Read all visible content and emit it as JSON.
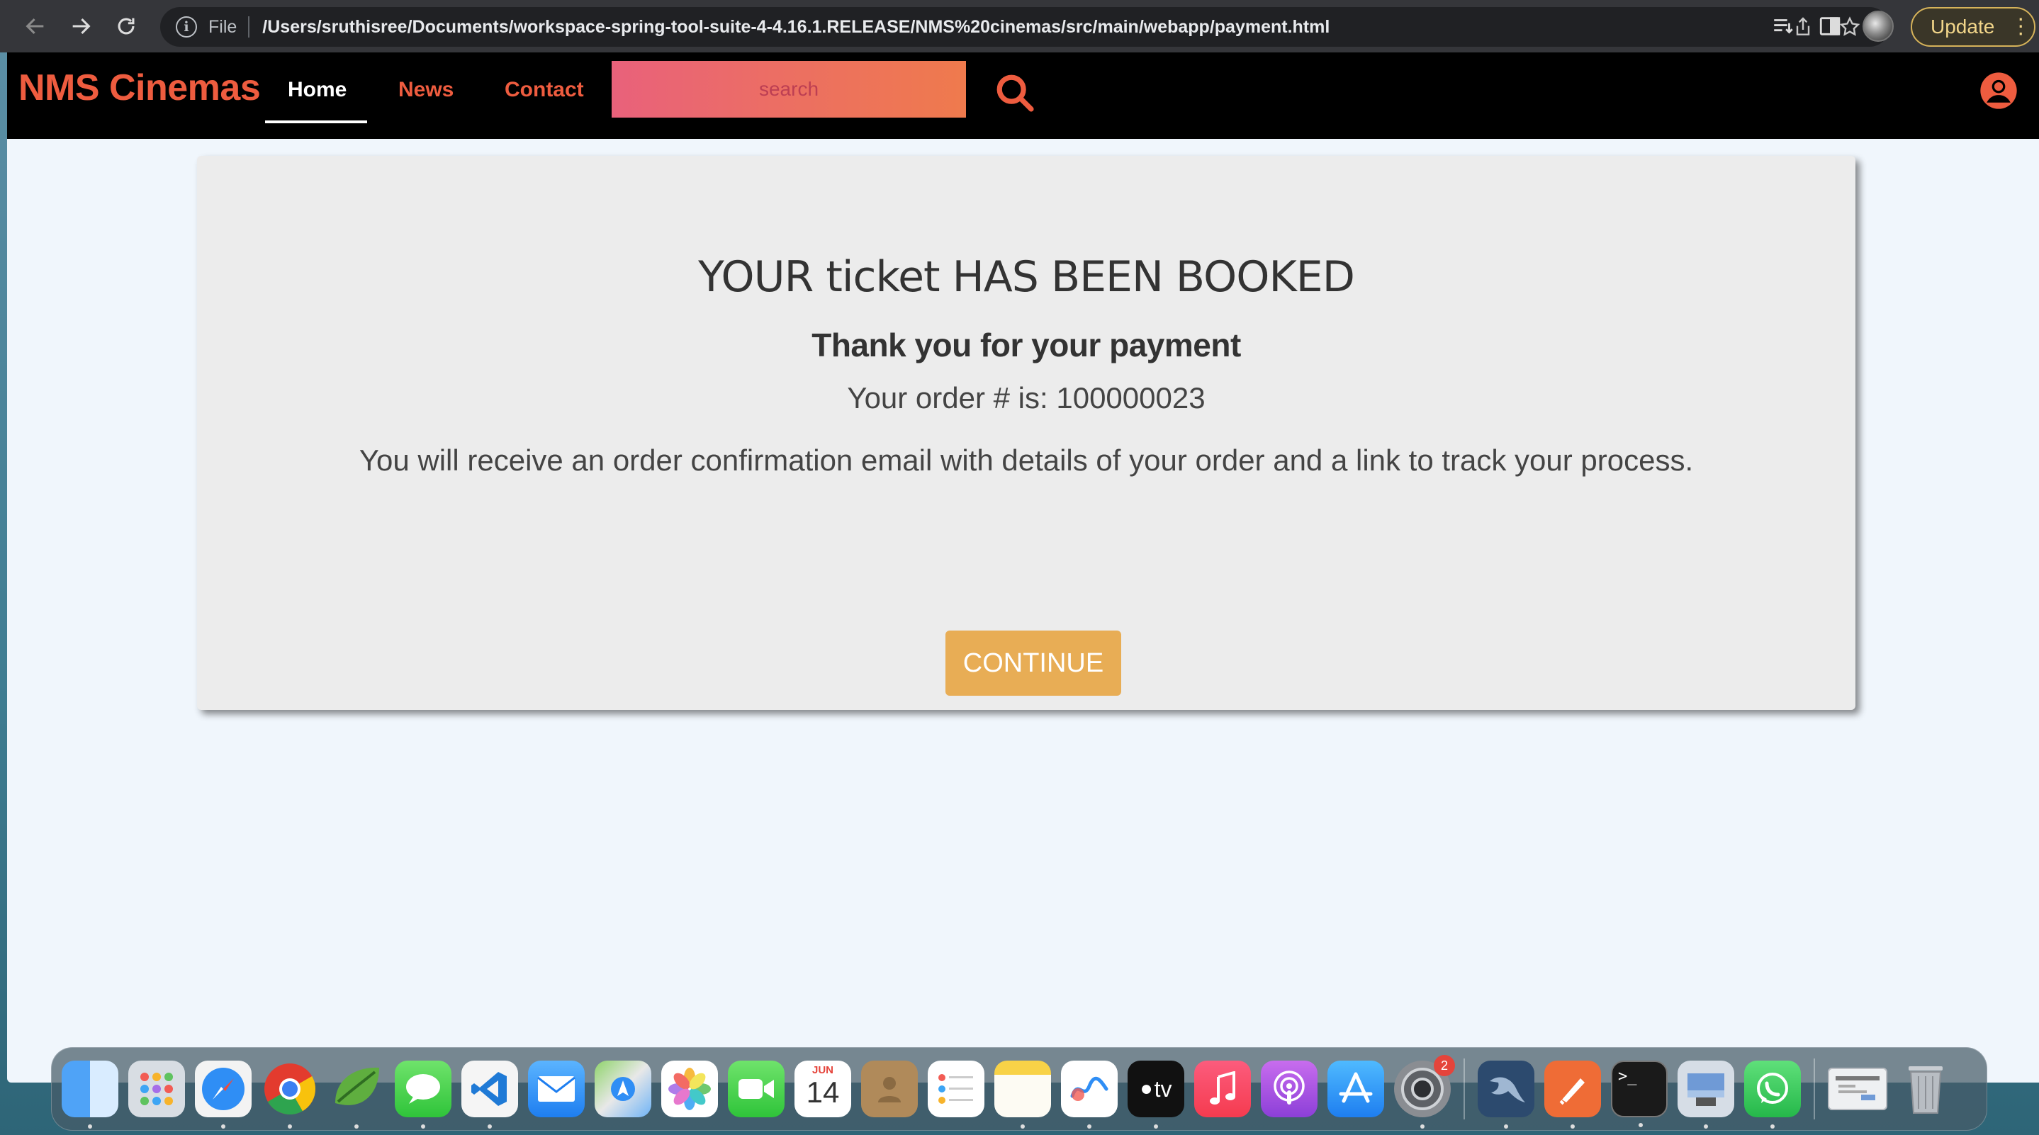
{
  "browser": {
    "scheme_label": "File",
    "url": "/Users/sruthisree/Documents/workspace-spring-tool-suite-4-4.16.1.RELEASE/NMS%20cinemas/src/main/webapp/payment.html",
    "update_label": "Update",
    "accent_color": "#f2d68a"
  },
  "site": {
    "brand": "NMS Cinemas",
    "nav": {
      "home": "Home",
      "news": "News",
      "contact": "Contact"
    },
    "search_placeholder": "search",
    "accent_color": "#ee5c3f"
  },
  "confirmation": {
    "title": "YOUR ticket HAS BEEN BOOKED",
    "subtitle": "Thank you for your payment",
    "order_line": "Your order # is: 100000023",
    "note": "You will receive an order confirmation email with details of your order and a link to track your process.",
    "continue_label": "CONTINUE",
    "button_color": "#e8ad55"
  },
  "dock": {
    "calendar_month": "JUN",
    "calendar_day": "14",
    "tv_label": "tv",
    "settings_badge": "2"
  }
}
